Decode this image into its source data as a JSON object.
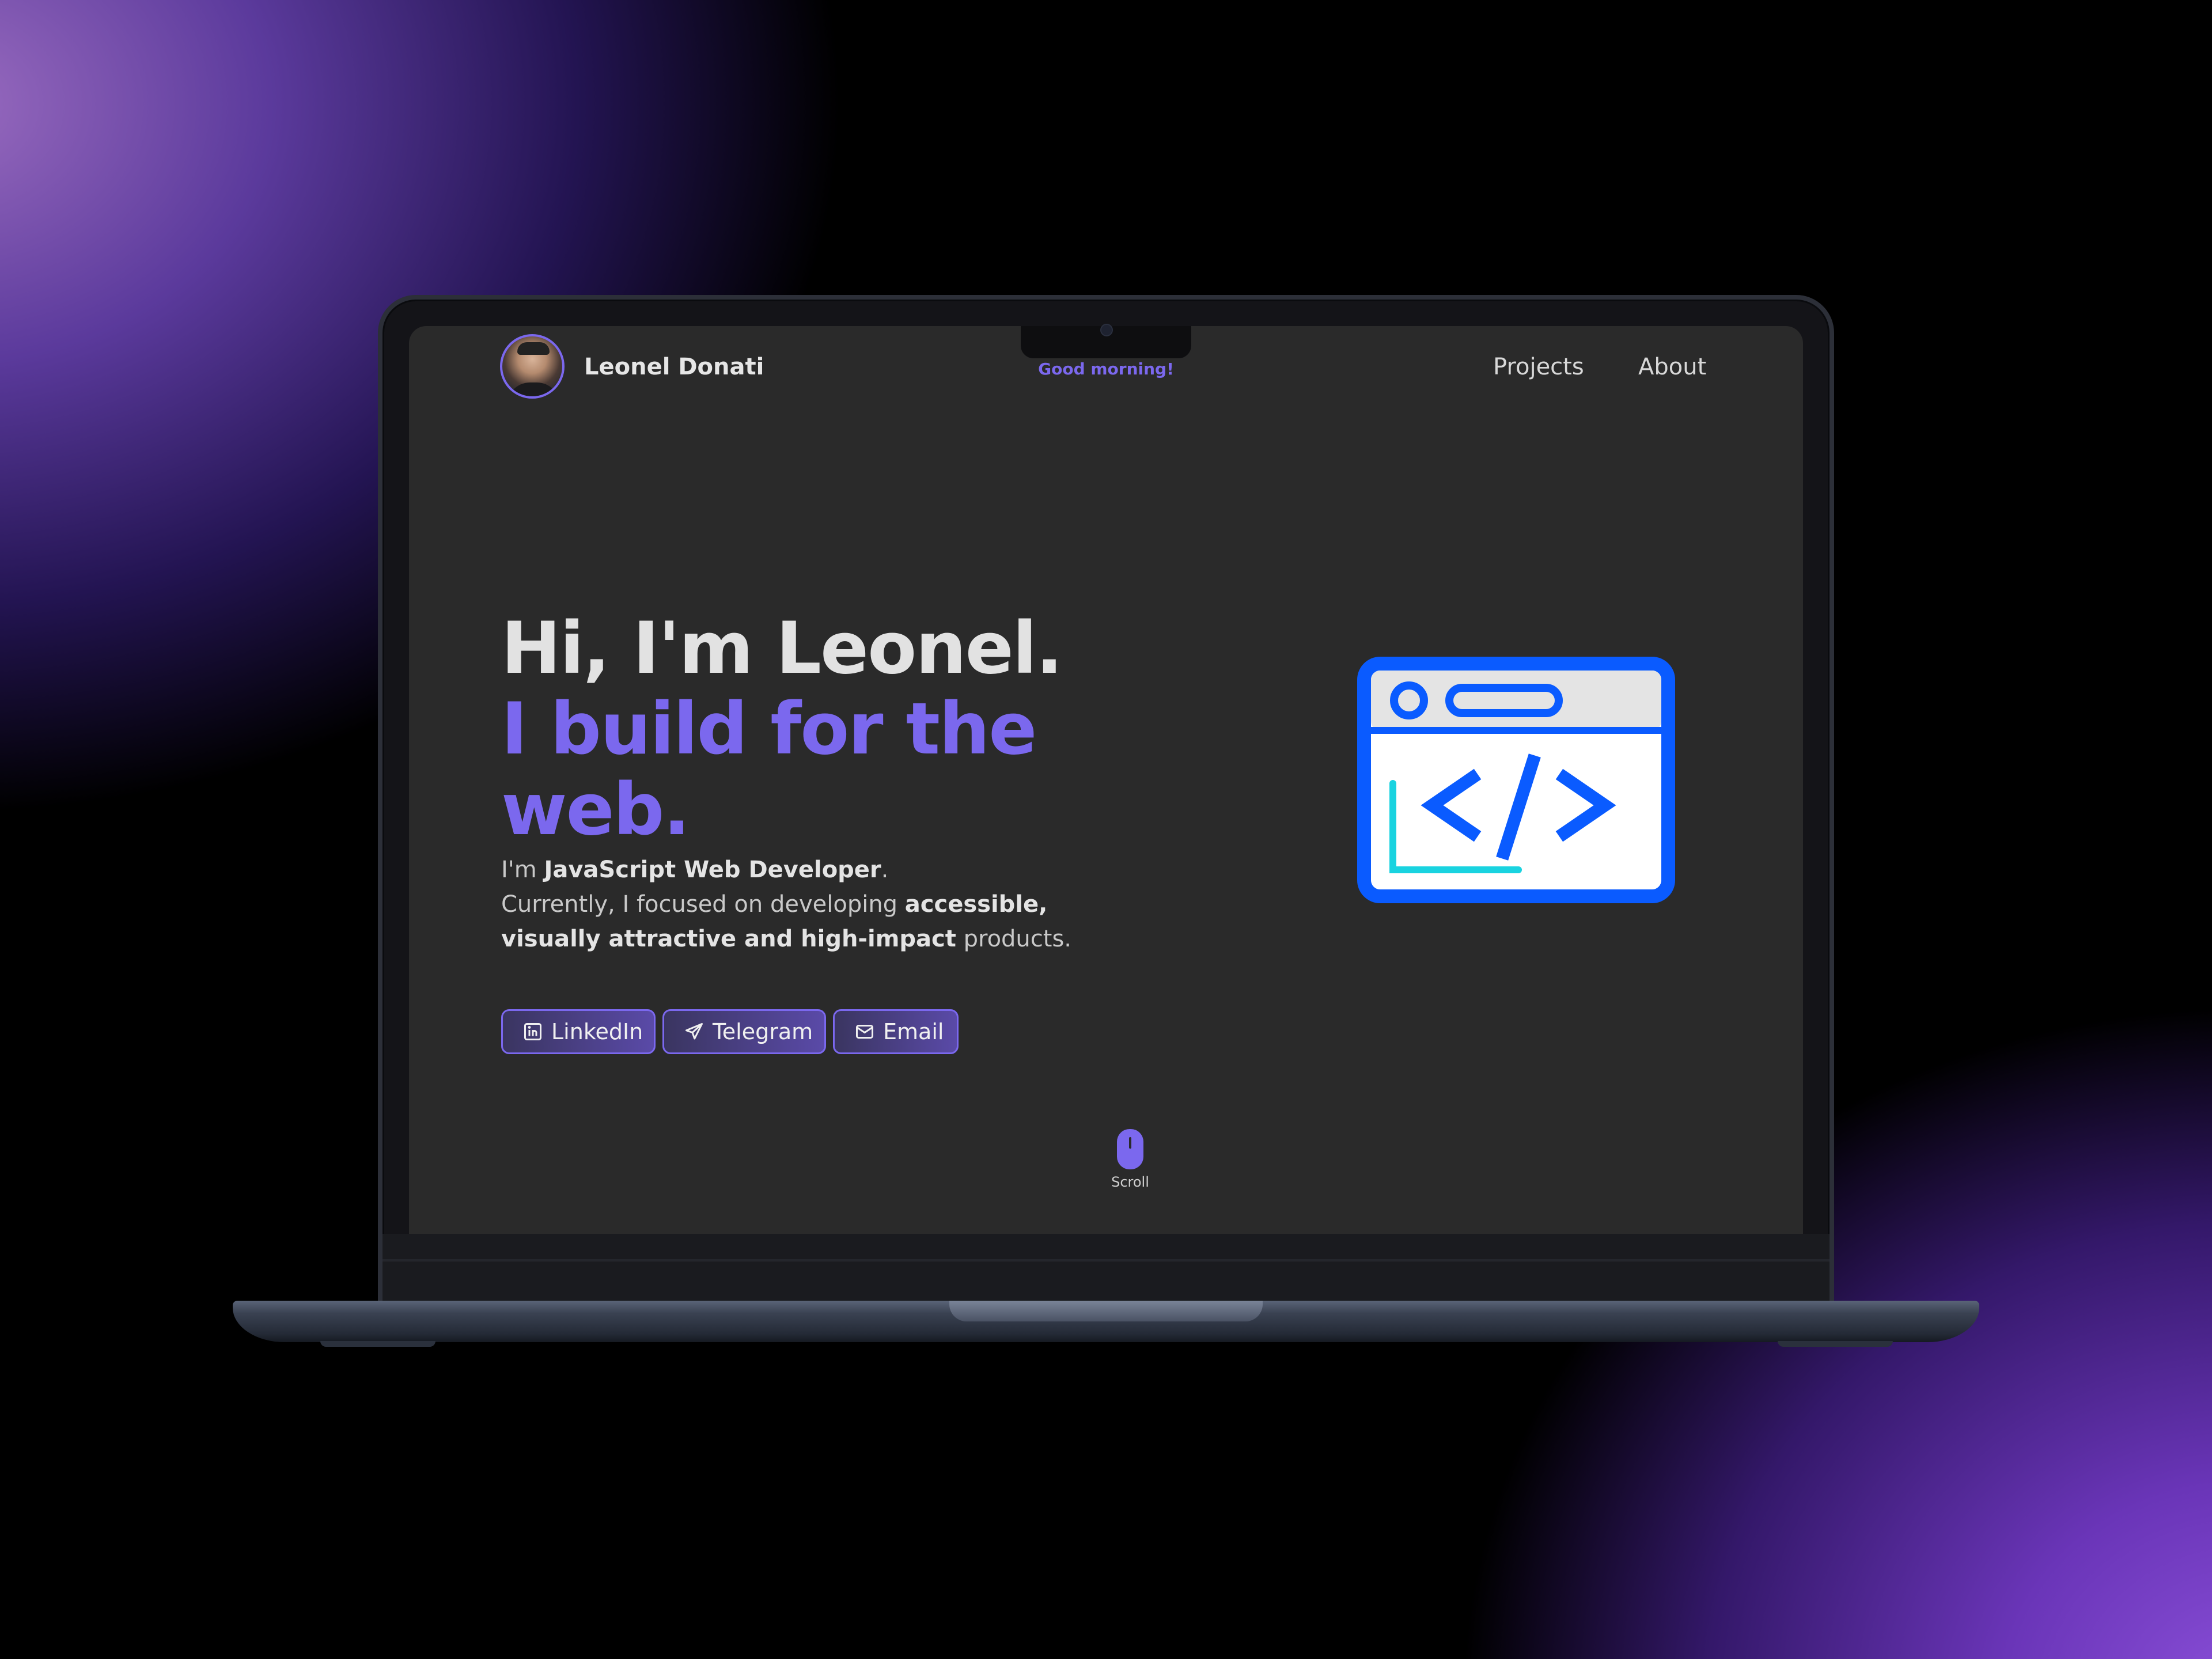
{
  "header": {
    "brand_name": "Leonel Donati",
    "greeting": "Good morning!",
    "nav": [
      {
        "label": "Projects",
        "icon": ""
      },
      {
        "label": "About",
        "icon": ""
      }
    ]
  },
  "hero": {
    "line1": "Hi, I'm Leonel.",
    "line2": "I build for the",
    "line3": "web.",
    "sub": {
      "p1_a": "I'm ",
      "p1_b": "JavaScript Web Developer",
      "p1_c": ".",
      "p2_a": "Currently, I focused on developing ",
      "p2_b": "accessible,",
      "p3_b": "visually attractive and high-impact",
      "p3_c": " products."
    }
  },
  "buttons": [
    {
      "label": "LinkedIn",
      "icon": "linkedin-icon"
    },
    {
      "label": "Telegram",
      "icon": "telegram-icon"
    },
    {
      "label": "Email",
      "icon": "mail-icon"
    }
  ],
  "scroll": {
    "label": "Scroll",
    "icon": "mouse-icon"
  },
  "colors": {
    "accent": "#7b68ee",
    "screen_bg": "#2a2a2a",
    "illustration_blue": "#0a5bff",
    "illustration_cyan": "#19d3e0"
  }
}
